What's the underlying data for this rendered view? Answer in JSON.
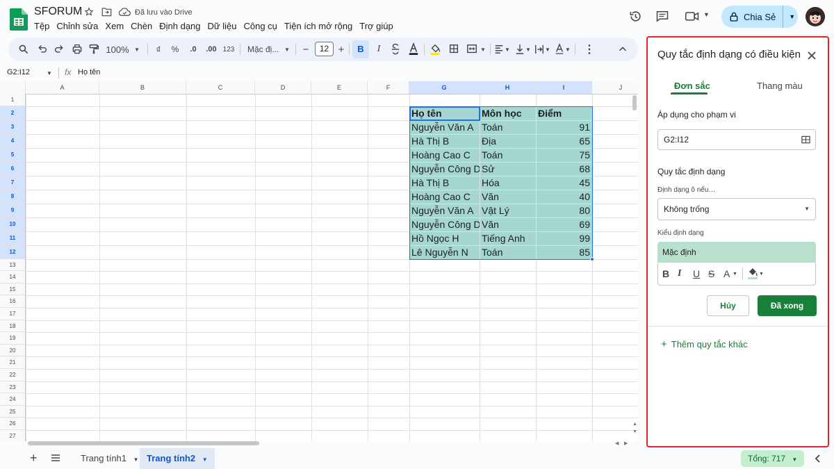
{
  "app": {
    "doc_title": "SFORUM",
    "saved_status": "Đã lưu vào Drive",
    "share_label": "Chia Sẻ",
    "menu": [
      "Tệp",
      "Chỉnh sửa",
      "Xem",
      "Chèn",
      "Định dạng",
      "Dữ liệu",
      "Công cụ",
      "Tiện ích mở rộng",
      "Trợ giúp"
    ]
  },
  "toolbar": {
    "zoom": "100%",
    "currency": "₫",
    "percent": "%",
    "decrease_decimal": ".0",
    "increase_decimal": ".00",
    "number_format": "123",
    "font_name": "Mặc đị...",
    "font_size": "12",
    "minus": "−",
    "plus": "+",
    "bold": "B",
    "italic": "I"
  },
  "formula_bar": {
    "name_box": "G2:I12",
    "fx": "fx",
    "content": "Họ tên"
  },
  "grid": {
    "columns": [
      "A",
      "B",
      "C",
      "D",
      "E",
      "F",
      "G",
      "H",
      "I",
      "J"
    ],
    "rows": [
      "1",
      "2",
      "3",
      "4",
      "5",
      "6",
      "7",
      "8",
      "9",
      "10",
      "11",
      "12",
      "13",
      "14",
      "15",
      "16",
      "17",
      "18",
      "19",
      "20",
      "21",
      "22",
      "23",
      "24",
      "25",
      "26",
      "27"
    ],
    "table": {
      "headers": [
        "Họ tên",
        "Môn học",
        "Điểm"
      ],
      "rows": [
        [
          "Nguyễn Văn A",
          "Toán",
          "91"
        ],
        [
          "Hà Thị B",
          "Địa",
          "65"
        ],
        [
          "Hoàng Cao C",
          "Toán",
          "75"
        ],
        [
          "Nguyễn Công D",
          "Sử",
          "68"
        ],
        [
          "Hà Thị B",
          "Hóa",
          "45"
        ],
        [
          "Hoàng Cao C",
          "Văn",
          "40"
        ],
        [
          "Nguyễn Văn A",
          "Vật Lý",
          "80"
        ],
        [
          "Nguyễn Công D",
          "Văn",
          "69"
        ],
        [
          "Hồ Ngọc H",
          "Tiếng Anh",
          "99"
        ],
        [
          "Lê Nguyễn N",
          "Toán",
          "85"
        ]
      ]
    }
  },
  "bottom": {
    "add": "+",
    "sheets": [
      "Trang tính1",
      "Trang tính2"
    ],
    "active_sheet": "Trang tính2",
    "sum": "Tổng: 717"
  },
  "panel": {
    "title": "Quy tắc định dạng có điều kiện",
    "tab_solid": "Đơn sắc",
    "tab_scale": "Thang màu",
    "apply_range_label": "Áp dụng cho phạm vi",
    "apply_range_value": "G2:I12",
    "rules_label": "Quy tắc định dạng",
    "condition_label": "Định dạng ô nếu…",
    "condition_value": "Không trống",
    "style_label": "Kiểu định dạng",
    "style_preview": "Mặc định",
    "cancel": "Hủy",
    "done": "Đã xong",
    "add_rule": "Thêm quy tắc khác"
  },
  "colors": {
    "accent_green": "#188038",
    "selection_fill": "#a5d6cf",
    "highlight_border": "#e5222a",
    "share_bg": "#c2e7ff"
  }
}
